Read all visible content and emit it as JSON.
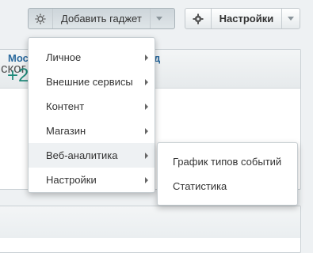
{
  "toolbar": {
    "add_gadget_label": "Добавить гаджет",
    "settings_label": "Настройки"
  },
  "background": {
    "panel_title_fragment": "ског",
    "link_left": "Мос",
    "link_right": "д",
    "metric": "+2"
  },
  "menu": {
    "items": [
      {
        "label": "Личное"
      },
      {
        "label": "Внешние сервисы"
      },
      {
        "label": "Контент"
      },
      {
        "label": "Магазин"
      },
      {
        "label": "Веб-аналитика"
      },
      {
        "label": "Настройки"
      }
    ],
    "highlighted_index": 4
  },
  "submenu": {
    "items": [
      {
        "label": "График типов событий"
      },
      {
        "label": "Статистика"
      }
    ]
  },
  "colors": {
    "link": "#2b6a9e",
    "metric": "#1f8a7a"
  }
}
